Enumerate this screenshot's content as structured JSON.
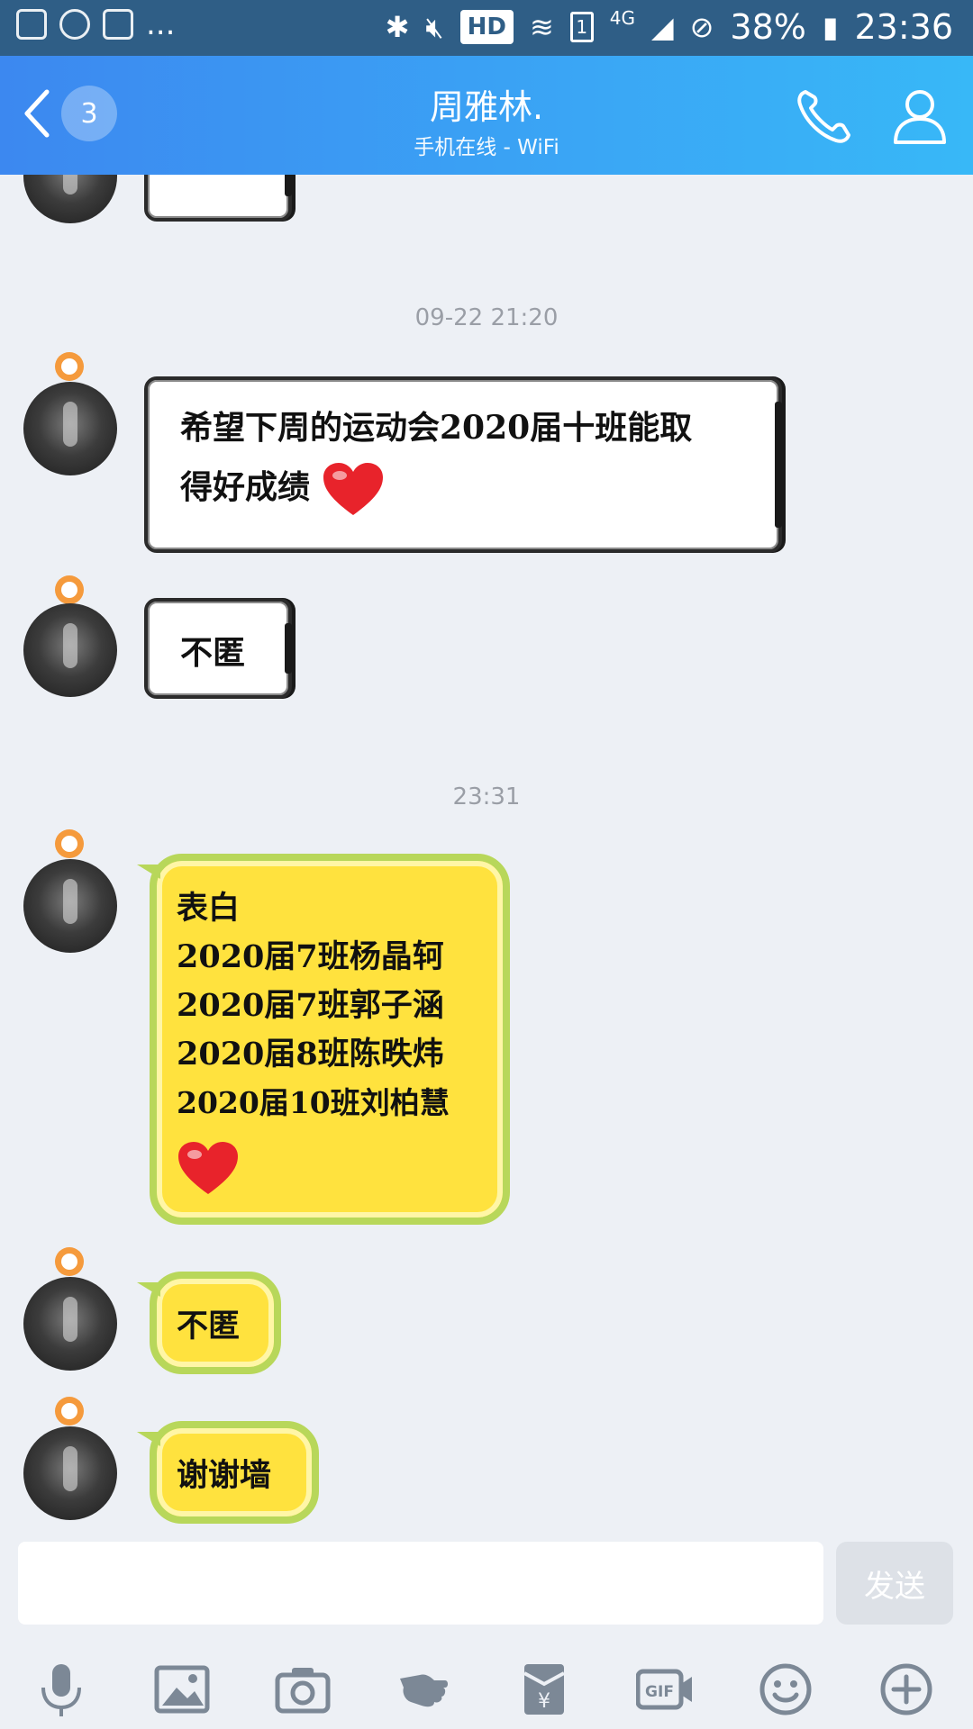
{
  "status_bar": {
    "battery": "38%",
    "time": "23:36",
    "hd": "HD",
    "network": "4G",
    "sim": "1",
    "more": "..."
  },
  "header": {
    "unread_count": "3",
    "title": "周雅林.",
    "subtitle": "手机在线 - WiFi"
  },
  "messages": {
    "ts1": "09-22 21:20",
    "msg1_line1": "希望下周的运动会2020届十班能取",
    "msg1_line2": "得好成绩",
    "msg2": "不匿",
    "ts2": "23:31",
    "msg3": [
      "表白",
      "2020届7班杨晶轲",
      "2020届7班郭子涵",
      "2020届8班陈昳炜",
      "2020届10班刘柏慧"
    ],
    "msg4": "不匿",
    "msg5": "谢谢墙"
  },
  "input": {
    "placeholder": "",
    "send_label": "发送"
  },
  "toolbar": [
    "mic-icon",
    "image-icon",
    "camera-icon",
    "poke-icon",
    "red-packet-icon",
    "gif-icon",
    "emoji-icon",
    "plus-icon"
  ],
  "colors": {
    "header_start": "#3c88f0",
    "header_end": "#38b8f7",
    "bubble_yellow": "#ffe23e",
    "bubble_border": "#b8d75a",
    "heart": "#e8232b"
  }
}
